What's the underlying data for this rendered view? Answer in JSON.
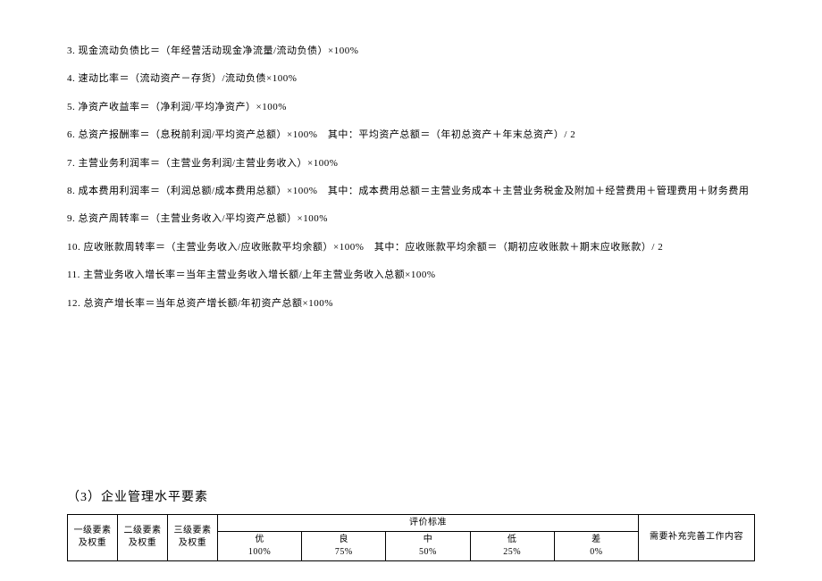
{
  "formulas": {
    "line3": "3. 现金流动负债比＝（年经营活动现金净流量/流动负债）×100%",
    "line4": "4. 速动比率＝（流动资产－存货）/流动负债×100%",
    "line5": "5. 净资产收益率＝（净利润/平均净资产）×100%",
    "line6": "6. 总资产报酬率＝（息税前利润/平均资产总额）×100%　其中：平均资产总额＝（年初总资产＋年末总资产）/ 2",
    "line7": "7. 主营业务利润率＝（主营业务利润/主营业务收入）×100%",
    "line8": "8. 成本费用利润率＝（利润总额/成本费用总额）×100%　其中：成本费用总额＝主营业务成本＋主营业务税金及附加＋经营费用＋管理费用＋财务费用",
    "line9": "9. 总资产周转率＝（主营业务收入/平均资产总额）×100%",
    "line10": "10. 应收账款周转率＝（主营业务收入/应收账款平均余额）×100%　其中：应收账款平均余额＝（期初应收账款＋期末应收账款）/ 2",
    "line11": "11. 主营业务收入增长率＝当年主营业务收入增长额/上年主营业务收入总额×100%",
    "line12": "12. 总资产增长率＝当年总资产增长额/年初资产总额×100%"
  },
  "section_title": "（3）企业管理水平要素",
  "table": {
    "header_row1": {
      "col1": "一级要素及权重",
      "col2": "二级要素及权重",
      "col3": "三级要素及权重",
      "criteria": "评价标准",
      "last": "需要补充完善工作内容"
    },
    "header_row2": {
      "g1_label": "优",
      "g1_pct": "100%",
      "g2_label": "良",
      "g2_pct": "75%",
      "g3_label": "中",
      "g3_pct": "50%",
      "g4_label": "低",
      "g4_pct": "25%",
      "g5_label": "差",
      "g5_pct": "0%"
    }
  }
}
